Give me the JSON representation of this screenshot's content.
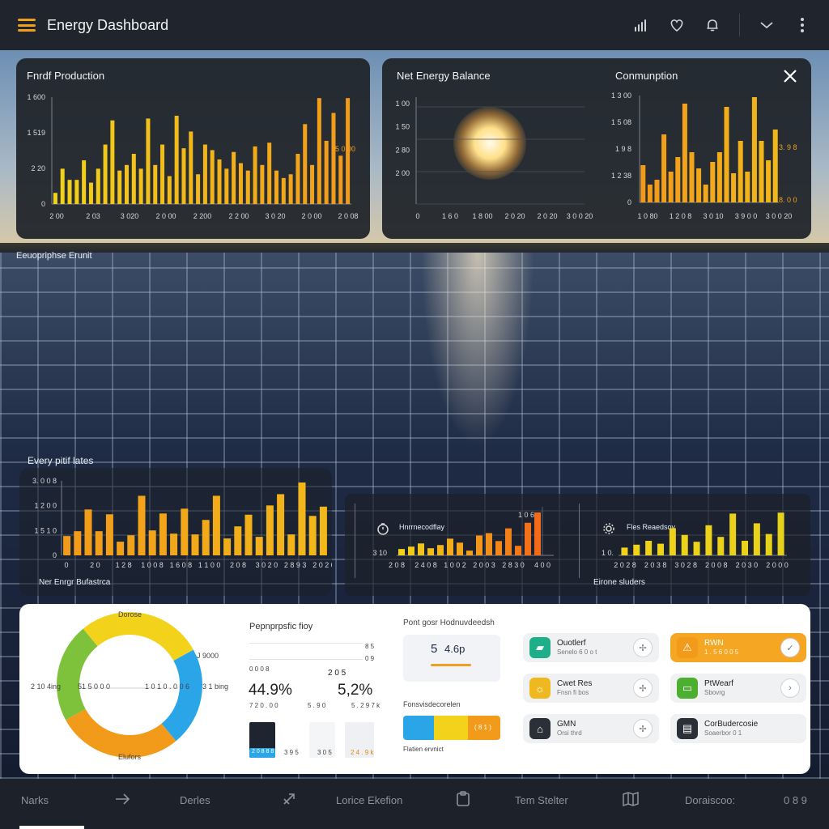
{
  "header": {
    "title": "Energy Dashboard"
  },
  "icons": {
    "menu": "hamburger-icon",
    "signal": "signal-icon",
    "heart": "heart-icon",
    "bell": "bell-icon",
    "chevron": "chevron-down-icon",
    "more": "more-vertical-icon"
  },
  "colors": {
    "yellow": "#f2d21a",
    "orange": "#f29a1a",
    "accent": "#f0a020",
    "blue": "#2aa6e8",
    "green": "#7ec23c"
  },
  "cards": {
    "production": {
      "title": "Fnrdf Production",
      "y_ticks": [
        "1 600",
        "1 519",
        "2 20",
        "0"
      ],
      "x_ticks": [
        "2 00",
        "2 03",
        "3 020",
        "2 0 00",
        "2 200",
        "2 2 00",
        "3 0 20",
        "2 0 00",
        "2 0 08"
      ],
      "marker": "5 0 00"
    },
    "balance": {
      "title": "Net Energy Balance",
      "y_ticks": [
        "1 00",
        "1 50",
        "2 80",
        "2 00"
      ],
      "x_ticks": [
        "0",
        "1 6 0",
        "1 8 00",
        "2 0 20",
        "2 0 20",
        "3 0 0 20"
      ]
    },
    "consumption": {
      "title": "Conmunption",
      "y_ticks": [
        "1 3 00",
        "1 5 08",
        "1 9 8",
        "1 2 38",
        "0"
      ],
      "x_ticks": [
        "1 0 80",
        "1 2 0 8",
        "3 0 10",
        "3 9 0 0",
        "3 0 0 20"
      ],
      "marker_top": "3. 9 8",
      "marker_bottom": "8. 0 0"
    },
    "caption_left": "Eeuopriphse Erunit",
    "every_title": "Every pitif lates",
    "every": {
      "y_ticks": [
        "3. 0 0 8",
        "1 2 0 0",
        "1 5 1 0",
        "0"
      ],
      "x_ticks": [
        "0",
        "2 0",
        "1 2 8",
        "1 0 0 8",
        "1 6 0 8",
        "1 1 0 0",
        "2 0 8",
        "3 0 2 0",
        "2 8 9 3",
        "2 0 2 0"
      ],
      "caption": "Ner Enrgr Bufastrca"
    },
    "mini1": {
      "label": "Hnrrnecodflay",
      "left_tick": "3 10",
      "top_tick": "1 0 6",
      "x_ticks": [
        "2 0 8",
        "2 4 0 8",
        "1 0 0 2",
        "2 0 0 3",
        "2 8 3 0",
        "4 0 0"
      ]
    },
    "mini2": {
      "label": "Fles Reaedsoy",
      "left_tick": "1 0.",
      "x_ticks": [
        "2 0 2 8",
        "2 0 3 8",
        "3 0 2 8",
        "2 0 0 8",
        "2 0 3 0",
        "2 0 0 0"
      ],
      "caption": "Eirone sluders"
    }
  },
  "chart_data": [
    {
      "type": "bar",
      "title": "Fnrdf Production",
      "values": [
        120,
        380,
        260,
        260,
        470,
        230,
        380,
        640,
        900,
        360,
        420,
        540,
        380,
        920,
        420,
        640,
        300,
        950,
        600,
        780,
        320,
        640,
        580,
        480,
        380,
        560,
        440,
        360,
        620,
        420,
        660,
        360,
        280,
        320,
        540,
        860,
        420,
        1140,
        680,
        980,
        520,
        1140
      ]
    },
    {
      "type": "bar",
      "title": "Conmunption",
      "values": [
        460,
        220,
        280,
        840,
        380,
        560,
        1220,
        620,
        420,
        220,
        500,
        620,
        1180,
        360,
        760,
        380,
        1300,
        760,
        520,
        900
      ]
    },
    {
      "type": "bar",
      "title": "Every pitif lates",
      "values": [
        480,
        600,
        1140,
        600,
        1020,
        340,
        500,
        1480,
        620,
        1040,
        540,
        1160,
        520,
        880,
        1480,
        420,
        720,
        1010,
        460,
        1240,
        1520,
        520,
        1810,
        980,
        1210
      ]
    },
    {
      "type": "bar",
      "title": "Hnrrnecodflay",
      "values": [
        160,
        220,
        300,
        180,
        260,
        420,
        320,
        120,
        500,
        560,
        360,
        680,
        240,
        820,
        1080
      ]
    },
    {
      "type": "bar",
      "title": "Fles Reaedsoy",
      "values": [
        160,
        220,
        300,
        240,
        560,
        420,
        280,
        620,
        380,
        860,
        300,
        660,
        440,
        880
      ]
    }
  ],
  "bottom_panel": {
    "donut": {
      "top_label": "Dorose",
      "right_label": "J 9000",
      "left_label": "2 10 4ing",
      "inner_left": "51 5 0 0 0",
      "inner_right": "1 0 1 0 . 0 0 6",
      "right_small": "3 1 bing",
      "bottom_label": "Elufors",
      "segments": [
        {
          "label": "yellow",
          "value": 28
        },
        {
          "label": "blue",
          "value": 22
        },
        {
          "label": "orange",
          "value": 28
        },
        {
          "label": "green",
          "value": 22
        }
      ]
    },
    "middle": {
      "title": "Pepnprpsfic fioy",
      "tick_top": "8 5",
      "tick_2": "0 9",
      "label_left": "0 0 0 8",
      "label_mid": "2 0 5",
      "pct_left": "44.9%",
      "pct_right": "5,2%",
      "sub_left": "7 2 0 . 0 0",
      "sub_mid": "5 . 9 0",
      "sub_right": "5 . 2 9 7 k",
      "bar_values": [
        "2 0 8 8 8",
        "3 9 5",
        "3 0 5",
        "2 4 . 9 k"
      ]
    },
    "forecast": {
      "title": "Pont gosr Hodnuvdeedsh",
      "value_a": "5",
      "value_b": "4.6p",
      "subtitle": "Fonsvisdecorelen",
      "pill": "( 8 1 )",
      "caption": "Flatien ervnict"
    },
    "tiles": [
      {
        "name": "Ouotlerf",
        "sub": "Senelo 6 0 o t",
        "icon_color": "#1fae8a",
        "icon": "▰",
        "action": "✢"
      },
      {
        "name": "RWN",
        "sub": "1 . 5 6 0 0 5",
        "icon_color": "#f29a1a",
        "icon": "⚠",
        "action": "✓",
        "highlight": true
      },
      {
        "name": "Cwet Res",
        "sub": "Fnsn fi bos",
        "icon_color": "#f0b820",
        "icon": "☼",
        "action": "✢"
      },
      {
        "name": "PtWearf",
        "sub": "Sbovrg",
        "icon_color": "#4caf30",
        "icon": "▭",
        "action": "›"
      },
      {
        "name": "GMN",
        "sub": "Orsi thrd",
        "icon_color": "#2b3038",
        "icon": "⌂",
        "action": "✢"
      },
      {
        "name": "CorBudercosie",
        "sub": "Soaerbor  0 1",
        "icon_color": "#2b3038",
        "icon": "▤",
        "action": ""
      }
    ]
  },
  "bottom_nav": {
    "items": [
      "Narks",
      "Derles",
      "Lorice Ekefion",
      "Tem Stelter",
      "Doraiscoo:",
      "0 8 9"
    ]
  }
}
